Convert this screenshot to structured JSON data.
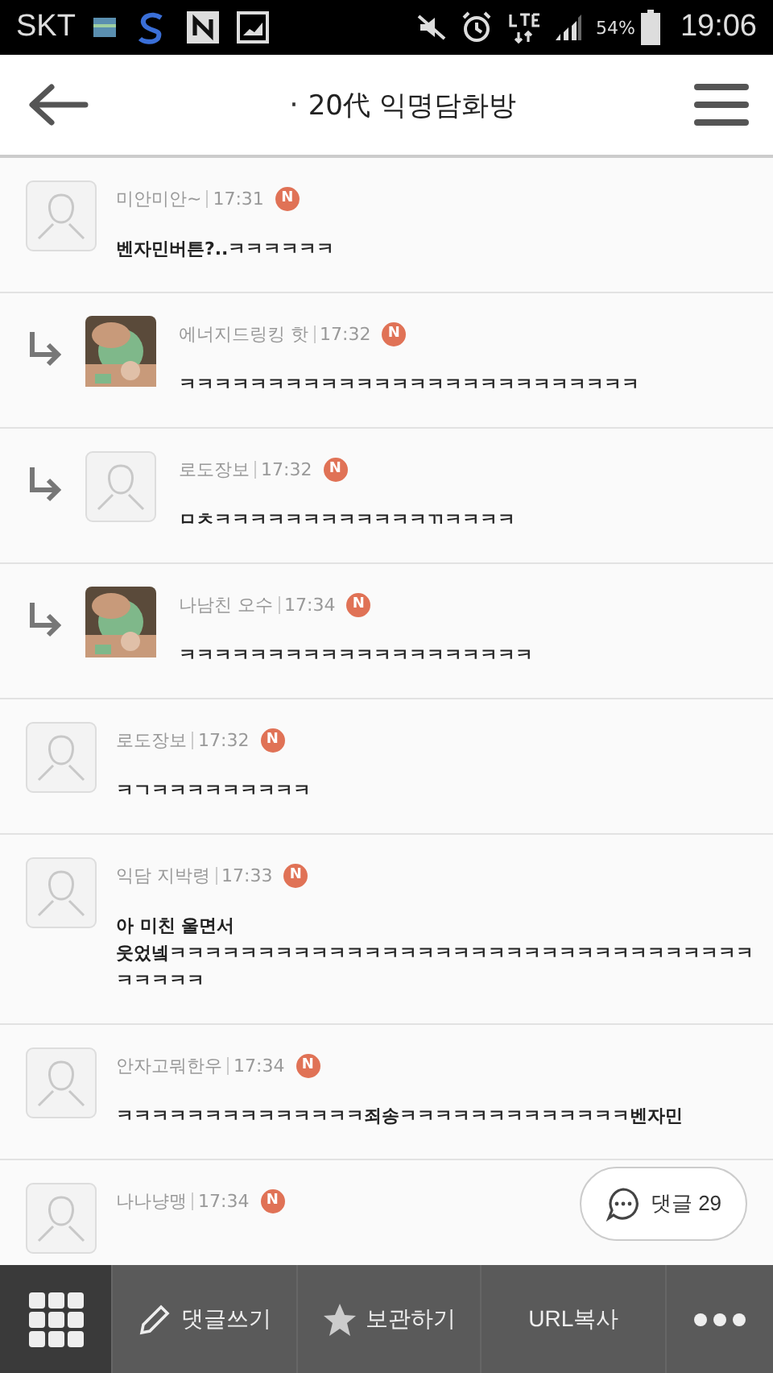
{
  "status_bar": {
    "carrier": "SKT",
    "battery": "54%",
    "time": "19:06"
  },
  "header": {
    "dot": "·",
    "title": "20代 익명담화방"
  },
  "comments": [
    {
      "reply": false,
      "kind": "default",
      "name": "미안미안~",
      "time": "17:31",
      "badge": "N",
      "text": "벤자민버튼?..ㅋㅋㅋㅋㅋㅋ"
    },
    {
      "reply": true,
      "kind": "picture",
      "name": "에너지드링킹 핫",
      "time": "17:32",
      "badge": "N",
      "text": "ㅋㅋㅋㅋㅋㅋㅋㅋㅋㅋㅋㅋㅋㅋㅋㅋㅋㅋㅋㅋㅋㅋㅋㅋㅋㅋ"
    },
    {
      "reply": true,
      "kind": "default",
      "name": "로도장보",
      "time": "17:32",
      "badge": "N",
      "text": "ㅁㅊㅋㅋㅋㅋㅋㅋㅋㅋㅋㅋㅋㅋㄲㅋㅋㅋㅋ"
    },
    {
      "reply": true,
      "kind": "picture",
      "name": "나남친 오수",
      "time": "17:34",
      "badge": "N",
      "text": "ㅋㅋㅋㅋㅋㅋㅋㅋㅋㅋㅋㅋㅋㅋㅋㅋㅋㅋㅋㅋ"
    },
    {
      "reply": false,
      "kind": "default",
      "name": "로도장보",
      "time": "17:32",
      "badge": "N",
      "text": "ㅋㄱㅋㅋㅋㅋㅋㅋㅋㅋㅋ"
    },
    {
      "reply": false,
      "kind": "default",
      "name": "익담 지박령",
      "time": "17:33",
      "badge": "N",
      "text": "아 미친 울면서 웃었넼ㅋㅋㅋㅋㅋㅋㅋㅋㅋㅋㅋㅋㅋㅋㅋㅋㅋㅋㅋㅋㅋㅋㅋㅋㅋㅋㅋㅋㅋㅋㅋㅋㅋㅋㅋㅋㅋㅋ"
    },
    {
      "reply": false,
      "kind": "default",
      "name": "안자고뭐한우",
      "time": "17:34",
      "badge": "N",
      "text": "ㅋㅋㅋㅋㅋㅋㅋㅋㅋㅋㅋㅋㅋㅋ죄송ㅋㅋㅋㅋㅋㅋㅋㅋㅋㅋㅋㅋㅋ벤자민"
    },
    {
      "reply": false,
      "kind": "default",
      "name": "나나냥맹",
      "time": "17:34",
      "badge": "N"
    }
  ],
  "comment_count_button": {
    "label": "댓글 29"
  },
  "bottom_bar": [
    {
      "kind": "grid"
    },
    {
      "kind": "write",
      "label": "댓글쓰기"
    },
    {
      "kind": "save",
      "label": "보관하기"
    },
    {
      "kind": "text",
      "label": "URL복사"
    },
    {
      "kind": "more"
    }
  ]
}
